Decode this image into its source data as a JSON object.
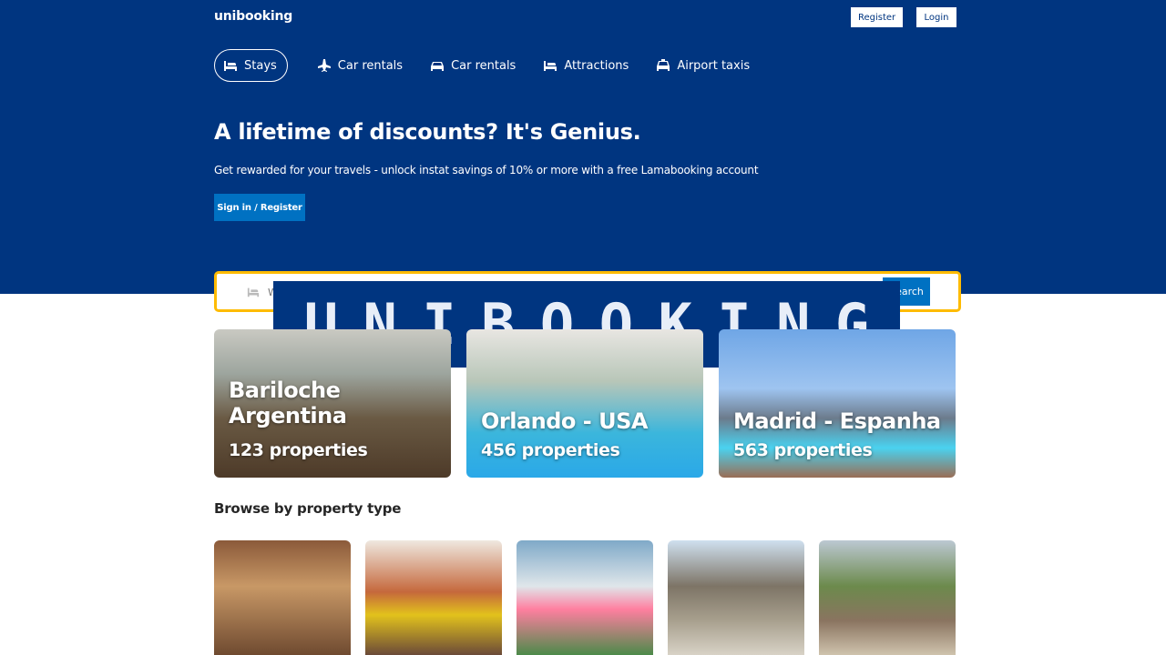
{
  "header": {
    "logo": "unibooking",
    "register_label": "Register",
    "login_label": "Login"
  },
  "nav": {
    "items": [
      {
        "label": "Stays",
        "icon": "bed-icon",
        "active": true
      },
      {
        "label": "Car rentals",
        "icon": "plane-icon",
        "active": false
      },
      {
        "label": "Car rentals",
        "icon": "car-icon",
        "active": false
      },
      {
        "label": "Attractions",
        "icon": "bed-icon",
        "active": false
      },
      {
        "label": "Airport taxis",
        "icon": "taxi-icon",
        "active": false
      }
    ]
  },
  "hero": {
    "title": "A lifetime of discounts? It's Genius.",
    "subtitle": "Get rewarded for your travels - unlock instat savings of 10% or more with a free Lamabooking account",
    "signin_label": "Sign in / Register"
  },
  "search": {
    "placeholder": "Where are you going?",
    "button_label": "Search"
  },
  "banner": {
    "text": "UNIBOOKING"
  },
  "featured": [
    {
      "title": "Bariloche Argentina",
      "properties": "123 properties"
    },
    {
      "title": "Orlando - USA",
      "properties": "456 properties"
    },
    {
      "title": "Madrid - Espanha",
      "properties": "563 properties"
    }
  ],
  "browse": {
    "title": "Browse by property type"
  },
  "colors": {
    "brand": "#003580",
    "accent": "#0071c2",
    "search_border": "#febb02"
  }
}
